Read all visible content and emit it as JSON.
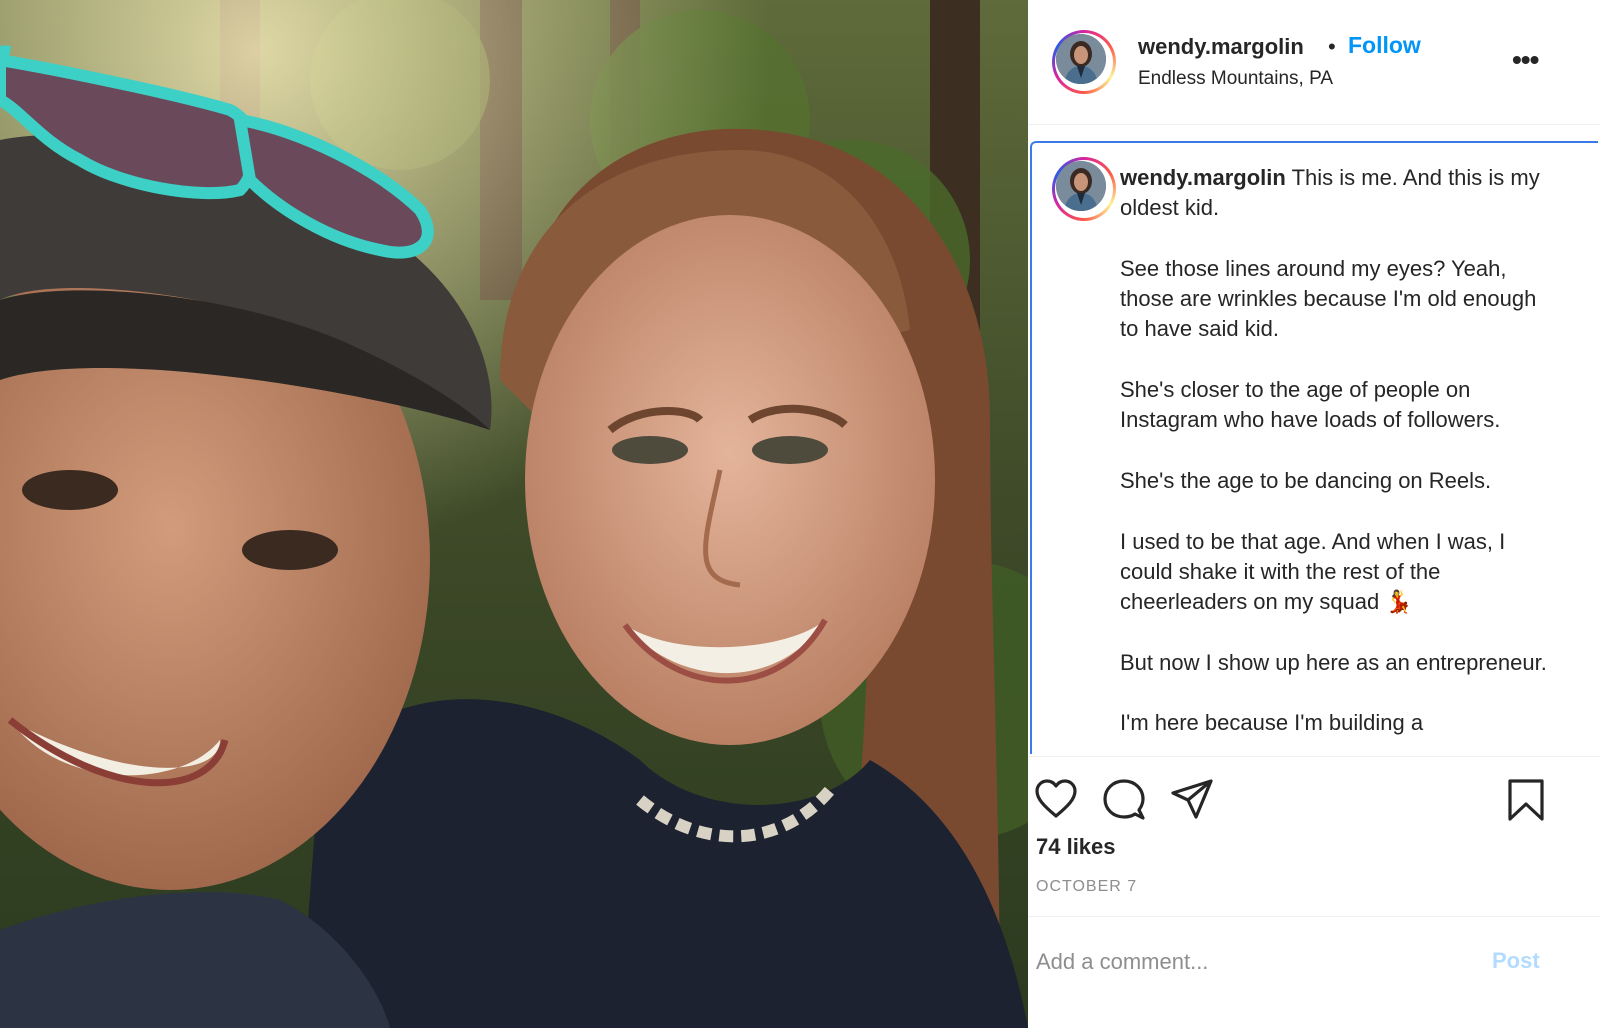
{
  "post": {
    "username": "wendy.margolin",
    "separator": "•",
    "follow_label": "Follow",
    "location": "Endless Mountains, PA",
    "more_label": "•••"
  },
  "caption": {
    "username": "wendy.margolin",
    "paragraphs": [
      "This is me. And this is my oldest kid.",
      "See those lines around my eyes? Yeah, those are wrinkles because I'm old enough to have said kid.",
      "She's closer to the age of people on Instagram who have loads of followers.",
      "She's the age to be dancing on Reels.",
      "I used to be that age. And when I was, I could shake it with the rest of the cheerleaders on my squad 💃",
      "But now I show up here as an entrepreneur.",
      "I'm here because I'm building a"
    ]
  },
  "actions": {
    "like_icon": "heart-icon",
    "comment_icon": "comment-icon",
    "share_icon": "share-icon",
    "save_icon": "bookmark-icon"
  },
  "stats": {
    "likes": "74 likes",
    "date": "OCTOBER 7"
  },
  "comment": {
    "placeholder": "Add a comment...",
    "post_label": "Post"
  },
  "colors": {
    "accent": "#0095f6",
    "post_disabled": "#b3dbff",
    "focus_border": "#3b7be8",
    "muted": "#8e8e8e"
  }
}
